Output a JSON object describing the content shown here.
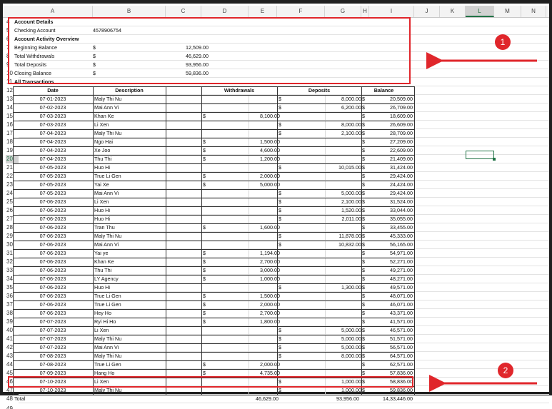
{
  "columns": [
    "A",
    "B",
    "C",
    "D",
    "E",
    "F",
    "G",
    "H",
    "I",
    "J",
    "K",
    "L",
    "M",
    "N"
  ],
  "selected_column": "L",
  "selected_row": "20",
  "summary_rows": [
    {
      "row": "4",
      "a": "Account Details",
      "b": "",
      "c": "",
      "bold": true
    },
    {
      "row": "5",
      "a": "Checking Account",
      "b": "4578906754",
      "c": "",
      "bold": false
    },
    {
      "row": "6",
      "a": "Account Activity Overview",
      "b": "",
      "c": "",
      "bold": true
    },
    {
      "row": "7",
      "a": "Beginning Balance",
      "b": "$",
      "c": "12,509.00",
      "bold": false
    },
    {
      "row": "8",
      "a": "Total Withdrawals",
      "b": "$",
      "c": "46,629.00",
      "bold": false
    },
    {
      "row": "9",
      "a": "Total Deposits",
      "b": "$",
      "c": "93,956.00",
      "bold": false
    },
    {
      "row": "10",
      "a": "Closing Balance",
      "b": "$",
      "c": "59,836.00",
      "bold": false
    },
    {
      "row": "11",
      "a": "All Transactions",
      "b": "",
      "c": "",
      "bold": true
    }
  ],
  "table_header": {
    "row": "12",
    "date": "Date",
    "description": "Description",
    "withdrawals": "Withdrawals",
    "deposits": "Deposits",
    "balance": "Balance"
  },
  "transactions": [
    {
      "row": "13",
      "date": "07-01-2023",
      "desc": "Maly Thi Nu",
      "wd": "",
      "dp": "8,000.00",
      "bal": "20,509.00"
    },
    {
      "row": "14",
      "date": "07-02-2023",
      "desc": "Mai Ann Vi",
      "wd": "",
      "dp": "6,200.00",
      "bal": "26,709.00"
    },
    {
      "row": "15",
      "date": "07-03-2023",
      "desc": "Khan Ke",
      "wd": "8,100.00",
      "dp": "",
      "bal": "18,609.00"
    },
    {
      "row": "16",
      "date": "07-03-2023",
      "desc": "Li Xen",
      "wd": "",
      "dp": "8,000.00",
      "bal": "26,609.00"
    },
    {
      "row": "17",
      "date": "07-04-2023",
      "desc": "Maly Thi Nu",
      "wd": "",
      "dp": "2,100.00",
      "bal": "28,709.00"
    },
    {
      "row": "18",
      "date": "07-04-2023",
      "desc": "Ngo Hai",
      "wd": "1,500.00",
      "dp": "",
      "bal": "27,209.00"
    },
    {
      "row": "19",
      "date": "07-04-2023",
      "desc": "Xe Joo",
      "wd": "4,600.00",
      "dp": "",
      "bal": "22,609.00"
    },
    {
      "row": "20",
      "date": "07-04-2023",
      "desc": "Thu Thi",
      "wd": "1,200.00",
      "dp": "",
      "bal": "21,409.00"
    },
    {
      "row": "21",
      "date": "07-05-2023",
      "desc": "Huo Hi",
      "wd": "",
      "dp": "10,015.00",
      "bal": "31,424.00"
    },
    {
      "row": "22",
      "date": "07-05-2023",
      "desc": "True Li Gen",
      "wd": "2,000.00",
      "dp": "",
      "bal": "29,424.00"
    },
    {
      "row": "23",
      "date": "07-05-2023",
      "desc": "Yai Xe",
      "wd": "5,000.00",
      "dp": "",
      "bal": "24,424.00"
    },
    {
      "row": "24",
      "date": "07-05-2023",
      "desc": "Mai Ann Vi",
      "wd": "",
      "dp": "5,000.00",
      "bal": "29,424.00"
    },
    {
      "row": "25",
      "date": "07-06-2023",
      "desc": "Li Xen",
      "wd": "",
      "dp": "2,100.00",
      "bal": "31,524.00"
    },
    {
      "row": "26",
      "date": "07-06-2023",
      "desc": "Huo Hi",
      "wd": "",
      "dp": "1,520.00",
      "bal": "33,044.00"
    },
    {
      "row": "27",
      "date": "07-06-2023",
      "desc": "Huo Hi",
      "wd": "",
      "dp": "2,011.00",
      "bal": "35,055.00"
    },
    {
      "row": "28",
      "date": "07-06-2023",
      "desc": "Tran Thu",
      "wd": "1,600.00",
      "dp": "",
      "bal": "33,455.00"
    },
    {
      "row": "29",
      "date": "07-06-2023",
      "desc": "Maly Thi Nu",
      "wd": "",
      "dp": "11,878.00",
      "bal": "45,333.00"
    },
    {
      "row": "30",
      "date": "07-06-2023",
      "desc": "Mai Ann Vi",
      "wd": "",
      "dp": "10,832.00",
      "bal": "56,165.00"
    },
    {
      "row": "31",
      "date": "07-06-2023",
      "desc": "Yai ye",
      "wd": "1,194.00",
      "dp": "",
      "bal": "54,971.00"
    },
    {
      "row": "32",
      "date": "07-06-2023",
      "desc": "Khan Ke",
      "wd": "2,700.00",
      "dp": "",
      "bal": "52,271.00"
    },
    {
      "row": "33",
      "date": "07-06-2023",
      "desc": "Thu Thi",
      "wd": "3,000.00",
      "dp": "",
      "bal": "49,271.00"
    },
    {
      "row": "34",
      "date": "07-06-2023",
      "desc": "LY Agency",
      "wd": "1,000.00",
      "dp": "",
      "bal": "48,271.00"
    },
    {
      "row": "35",
      "date": "07-06-2023",
      "desc": "Huo Hi",
      "wd": "",
      "dp": "1,300.00",
      "bal": "49,571.00"
    },
    {
      "row": "36",
      "date": "07-06-2023",
      "desc": "True Li Gen",
      "wd": "1,500.00",
      "dp": "",
      "bal": "48,071.00"
    },
    {
      "row": "37",
      "date": "07-06-2023",
      "desc": "True Li Gen",
      "wd": "2,000.00",
      "dp": "",
      "bal": "46,071.00"
    },
    {
      "row": "38",
      "date": "07-06-2023",
      "desc": "Hey Ho",
      "wd": "2,700.00",
      "dp": "",
      "bal": "43,371.00"
    },
    {
      "row": "39",
      "date": "07-07-2023",
      "desc": "Ryi Hi Ho",
      "wd": "1,800.00",
      "dp": "",
      "bal": "41,571.00"
    },
    {
      "row": "40",
      "date": "07-07-2023",
      "desc": "Li Xen",
      "wd": "",
      "dp": "5,000.00",
      "bal": "46,571.00"
    },
    {
      "row": "41",
      "date": "07-07-2023",
      "desc": "Maly Thi Nu",
      "wd": "",
      "dp": "5,000.00",
      "bal": "51,571.00"
    },
    {
      "row": "42",
      "date": "07-07-2023",
      "desc": "Mai Ann Vi",
      "wd": "",
      "dp": "5,000.00",
      "bal": "56,571.00"
    },
    {
      "row": "43",
      "date": "07-08-2023",
      "desc": "Maly Thi Nu",
      "wd": "",
      "dp": "8,000.00",
      "bal": "64,571.00"
    },
    {
      "row": "44",
      "date": "07-08-2023",
      "desc": "True Li Gen",
      "wd": "2,000.00",
      "dp": "",
      "bal": "62,571.00"
    },
    {
      "row": "45",
      "date": "07-09-2023",
      "desc": "Hang Ho",
      "wd": "4,735.00",
      "dp": "",
      "bal": "57,836.00"
    },
    {
      "row": "46",
      "date": "07-10-2023",
      "desc": "Li Xen",
      "wd": "",
      "dp": "1,000.00",
      "bal": "58,836.00"
    },
    {
      "row": "47",
      "date": "07-10-2023",
      "desc": "Maly Thi Nu",
      "wd": "",
      "dp": "1,000.00",
      "bal": "59,836.00"
    }
  ],
  "total_row": {
    "row": "48",
    "label": "Total",
    "wd": "46,629.00",
    "dp": "93,956.00",
    "bal": "14,33,446.00"
  },
  "last_row": {
    "row": "49"
  },
  "currency_symbol": "$",
  "annotations": [
    {
      "label": "1"
    },
    {
      "label": "2"
    }
  ],
  "colors": {
    "highlight": "#e0262b",
    "excel_green": "#217346"
  }
}
